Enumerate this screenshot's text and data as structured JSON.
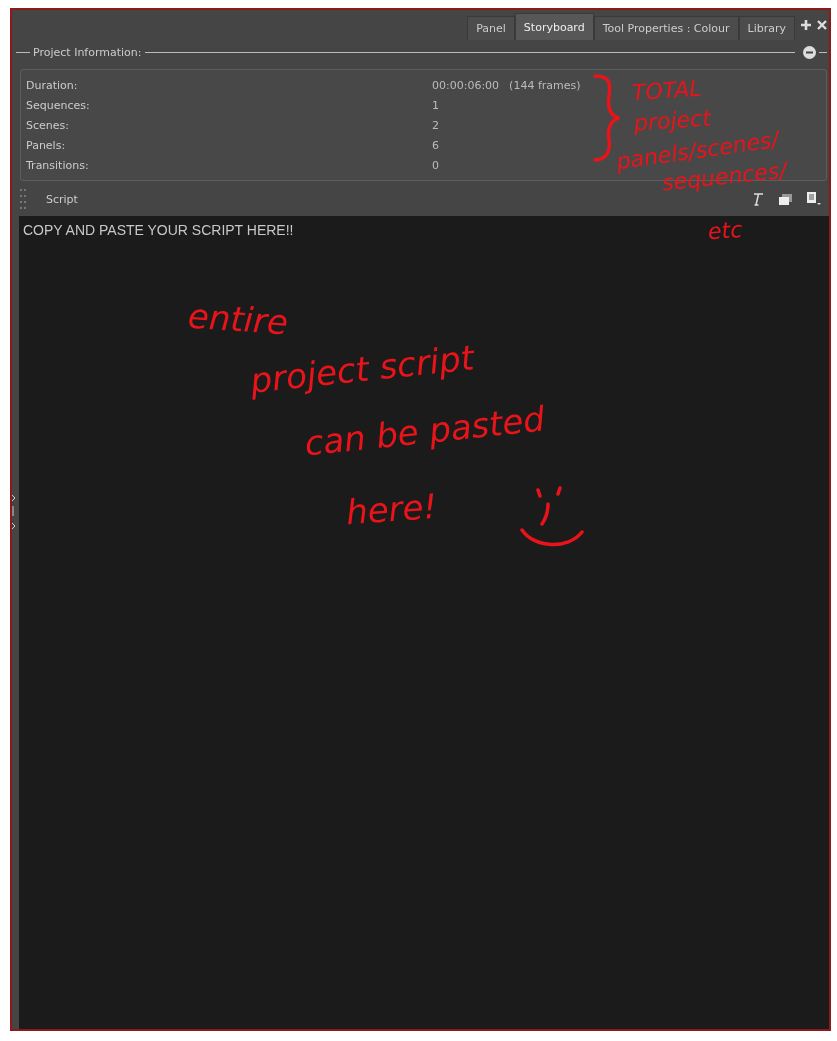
{
  "tabs": [
    {
      "label": "Panel",
      "selected": false
    },
    {
      "label": "Storyboard",
      "selected": true
    },
    {
      "label": "Tool Properties : Colour",
      "selected": false
    },
    {
      "label": "Library",
      "selected": false
    }
  ],
  "project_information": {
    "title": "Project Information:",
    "rows": [
      {
        "label": "Duration:",
        "value": "00:00:06:00",
        "extra": "(144 frames)"
      },
      {
        "label": "Sequences:",
        "value": "1"
      },
      {
        "label": "Scenes:",
        "value": "2"
      },
      {
        "label": "Panels:",
        "value": "6"
      },
      {
        "label": "Transitions:",
        "value": "0"
      }
    ]
  },
  "script": {
    "title": "Script",
    "text": "COPY AND PASTE YOUR SCRIPT HERE!!"
  },
  "annotations": [
    {
      "text": "TOTAL"
    },
    {
      "text": "project"
    },
    {
      "text": "panels/scenes/"
    },
    {
      "text": "sequences/"
    },
    {
      "text": "etc"
    },
    {
      "text": "entire"
    },
    {
      "text": "project script"
    },
    {
      "text": "can be pasted"
    },
    {
      "text": "here!"
    }
  ]
}
